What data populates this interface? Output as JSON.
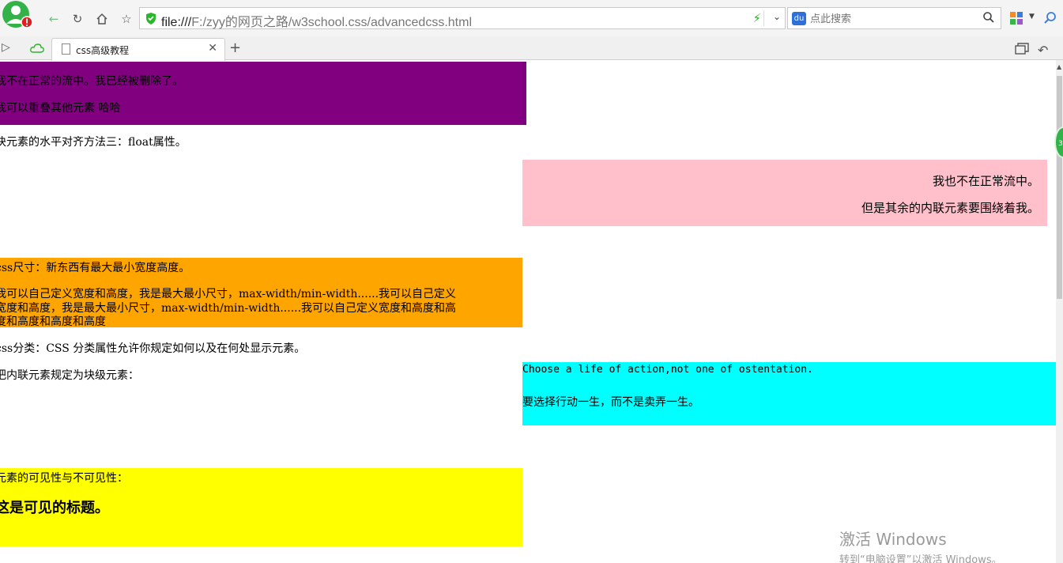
{
  "browser": {
    "url_host": "file:///",
    "url_path": "F:/zyy的网页之路/w3school.css/advancedcss.html",
    "search_placeholder": "点此搜索",
    "tab_title": "css高级教程",
    "colors": {
      "accent_green": "#2db52d",
      "avatar_green": "#34b24a",
      "alert_red": "#e02020"
    }
  },
  "page": {
    "purple_box": {
      "line1": "我不在正常的流中。我已经被删除了。",
      "line2": "我可以重叠其他元素 哈哈",
      "color": "#800080"
    },
    "float_heading": "块元素的水平对齐方法三：float属性。",
    "pink_box": {
      "line1": "我也不在正常流中。",
      "line2": "但是其余的内联元素要围绕着我。",
      "color": "#ffc0cb"
    },
    "orange_box": {
      "title": "css尺寸：新东西有最大最小宽度高度。",
      "body1": "我可以自己定义宽度和高度，我是最大最小尺寸，max-width/min-width......我可以自己定义",
      "body2": "宽度和高度，我是最大最小尺寸，max-width/min-width......我可以自己定义宽度和高度和高",
      "body3": "度和高度和高度和高度",
      "color": "#ffa500"
    },
    "classify_text": "css分类：CSS 分类属性允许你规定如何以及在何处显示元素。",
    "inline_block_text": "把内联元素规定为块级元素：",
    "cyan_box": {
      "line1": "Choose a life of action,not one of ostentation.",
      "line2": "要选择行动一生，而不是卖弄一生。",
      "color": "#00ffff"
    },
    "yellow_box": {
      "line1": "元素的可见性与不可见性：",
      "heading": "这是可见的标题。",
      "color": "#ffff00"
    }
  },
  "side_badge": "3",
  "watermark": {
    "line1": "激活 Windows",
    "line2": "转到“电脑设置”以激活 Windows。"
  }
}
